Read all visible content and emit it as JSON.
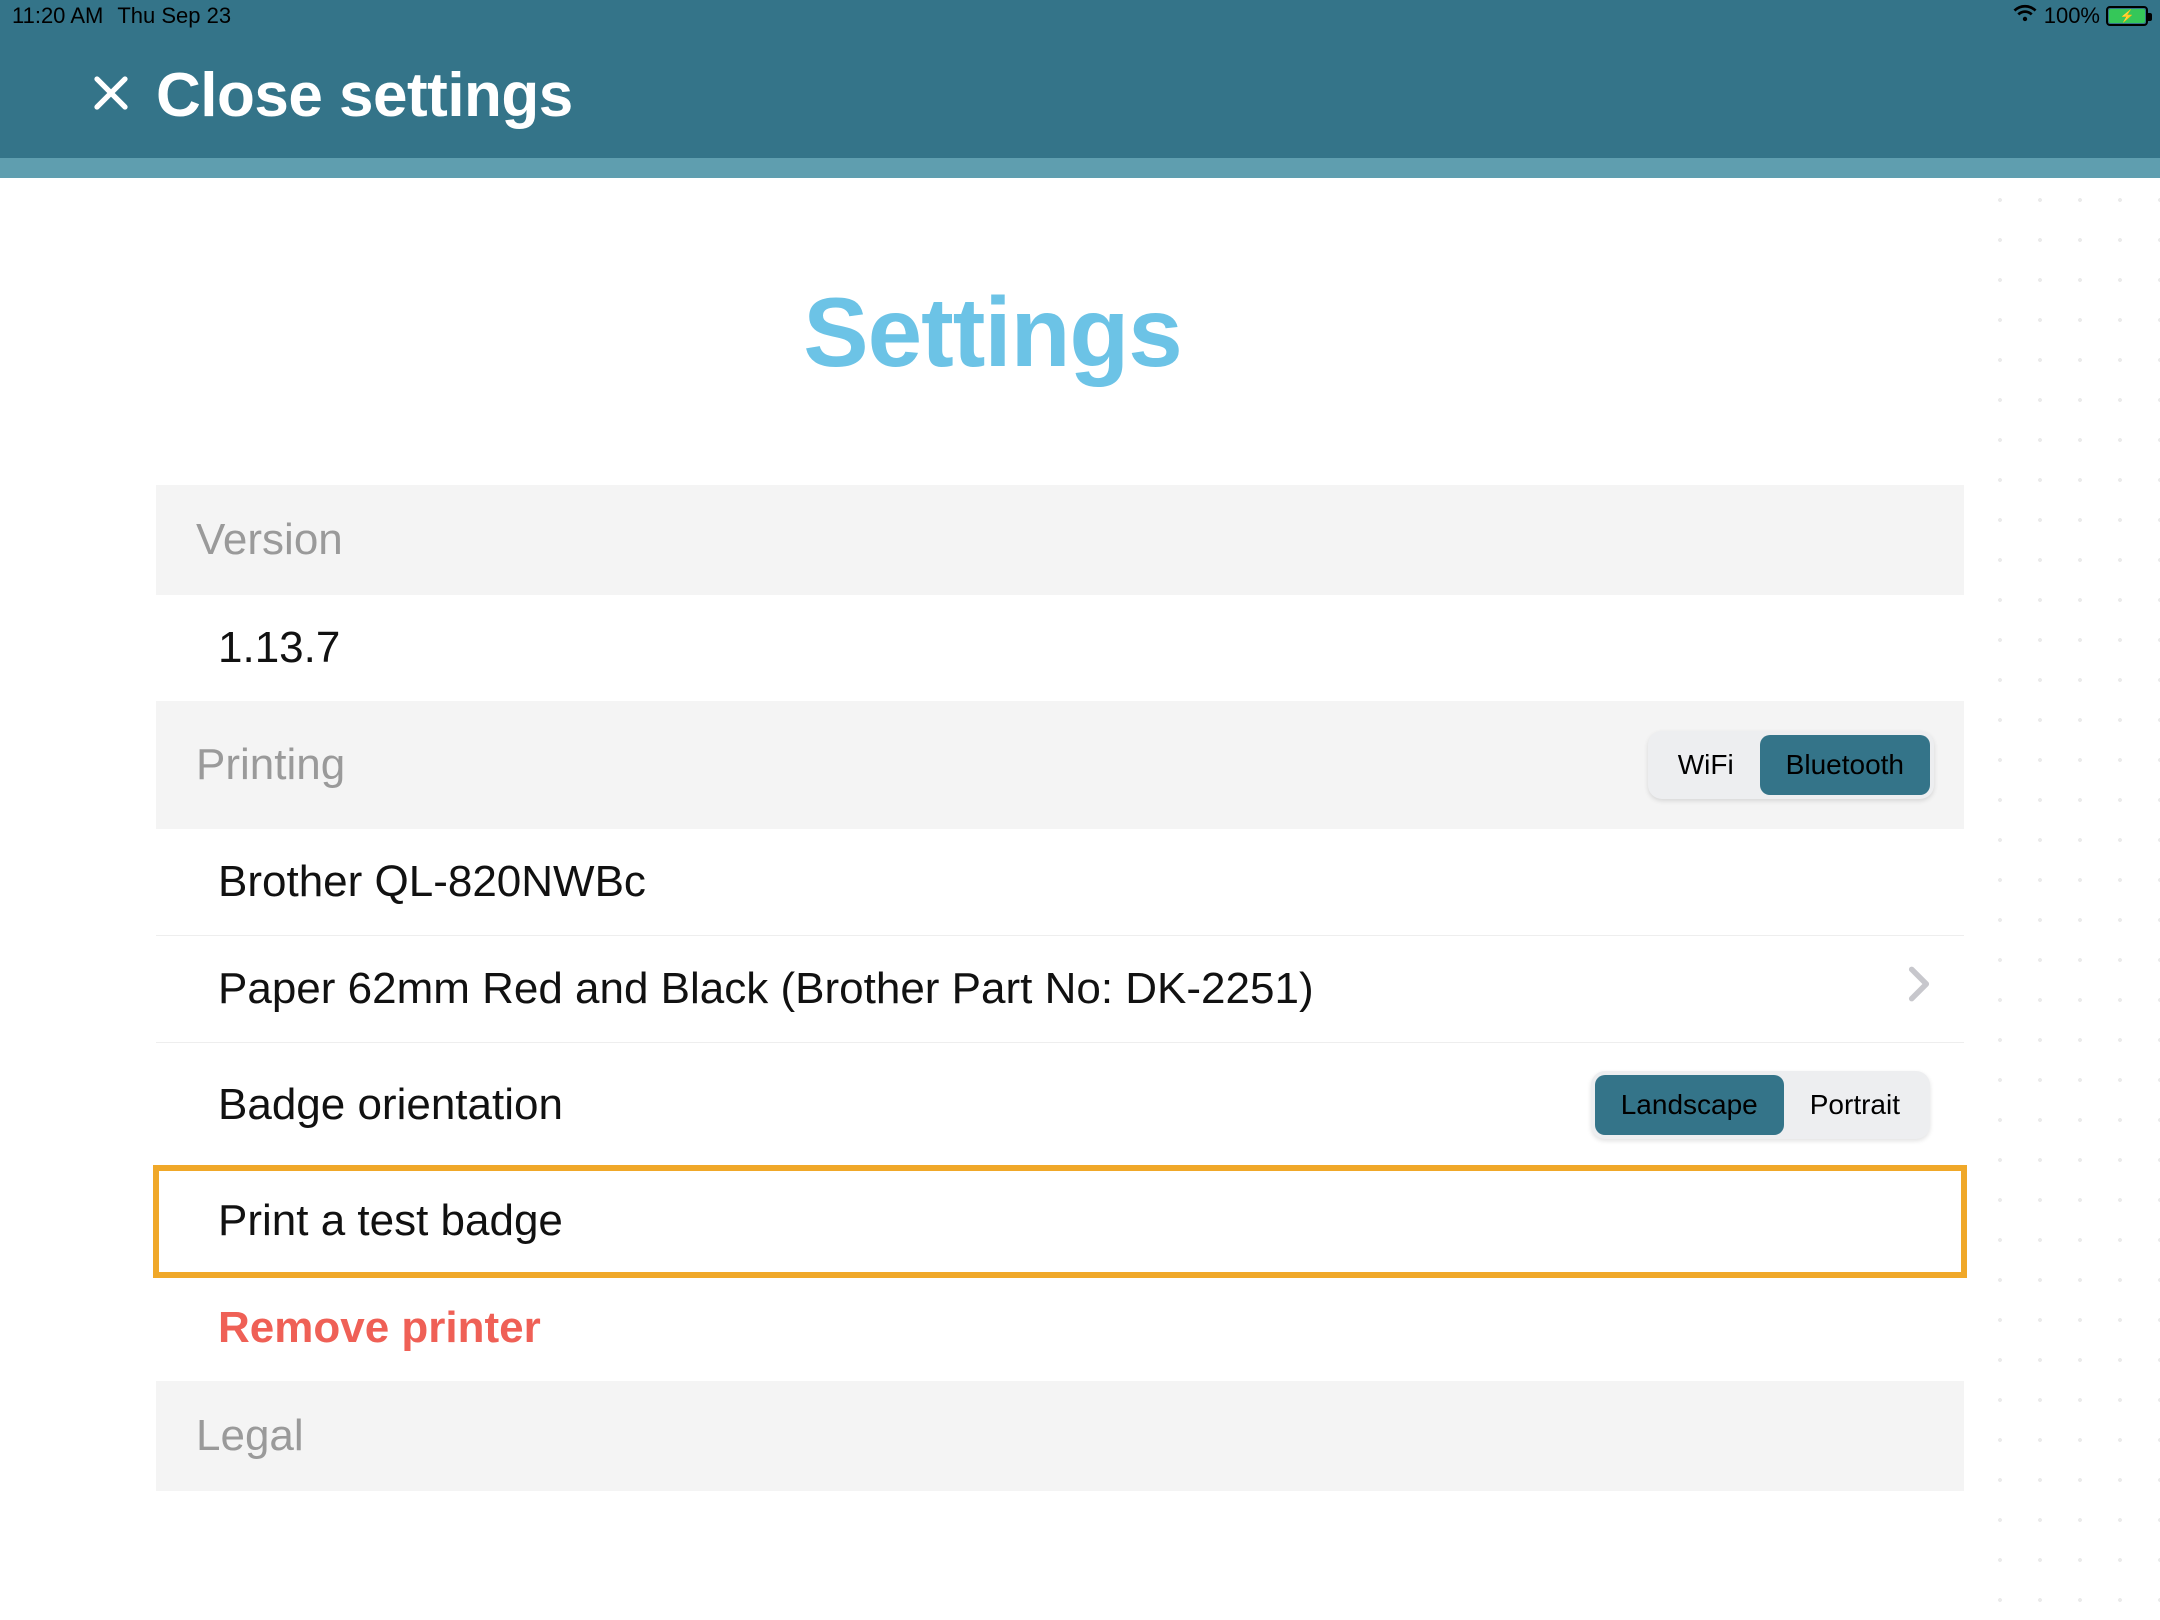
{
  "status": {
    "time": "11:20 AM",
    "date": "Thu Sep 23",
    "battery_pct": "100%",
    "battery_color": "#35c759"
  },
  "nav": {
    "title": "Close settings"
  },
  "page": {
    "title": "Settings"
  },
  "version": {
    "header": "Version",
    "value": "1.13.7"
  },
  "printing": {
    "header": "Printing",
    "connection": {
      "options": [
        "WiFi",
        "Bluetooth"
      ],
      "selected": "Bluetooth"
    },
    "printer_name": "Brother QL-820NWBc",
    "paper": "Paper 62mm Red and Black (Brother Part No: DK-2251)",
    "orientation": {
      "label": "Badge orientation",
      "options": [
        "Landscape",
        "Portrait"
      ],
      "selected": "Landscape"
    },
    "test_badge": "Print a test badge",
    "remove": "Remove printer"
  },
  "legal": {
    "header": "Legal"
  },
  "colors": {
    "teal": "#347489",
    "teal_light": "#5f9eaf",
    "title_blue": "#6cc3e6",
    "danger": "#ef6056",
    "highlight": "#f0a829"
  }
}
